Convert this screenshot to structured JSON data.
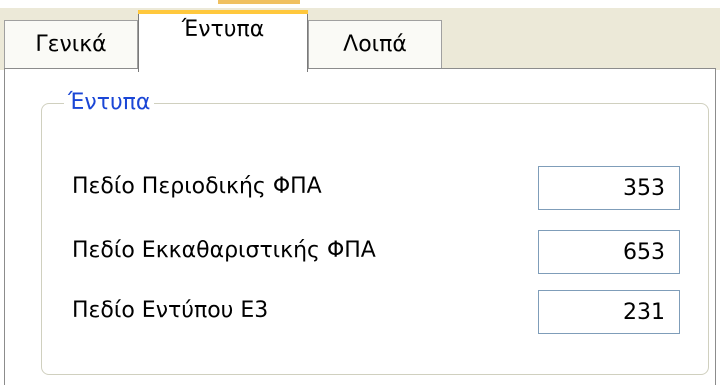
{
  "tabs": [
    {
      "label": "Γενικά",
      "active": false
    },
    {
      "label": "Έντυπα",
      "active": true
    },
    {
      "label": "Λοιπά",
      "active": false
    }
  ],
  "group": {
    "title": "Έντυπα",
    "fields": [
      {
        "label": "Πεδίο Περιοδικής ΦΠΑ",
        "value": "353"
      },
      {
        "label": "Πεδίο Εκκαθαριστικής ΦΠΑ",
        "value": "653"
      },
      {
        "label": "Πεδίο Εντύπου Ε3",
        "value": "231"
      }
    ]
  },
  "colors": {
    "group_title": "#1a46d6",
    "active_tab_highlight": "#ffc83d",
    "tab_strip_background": "#ece9d8"
  }
}
